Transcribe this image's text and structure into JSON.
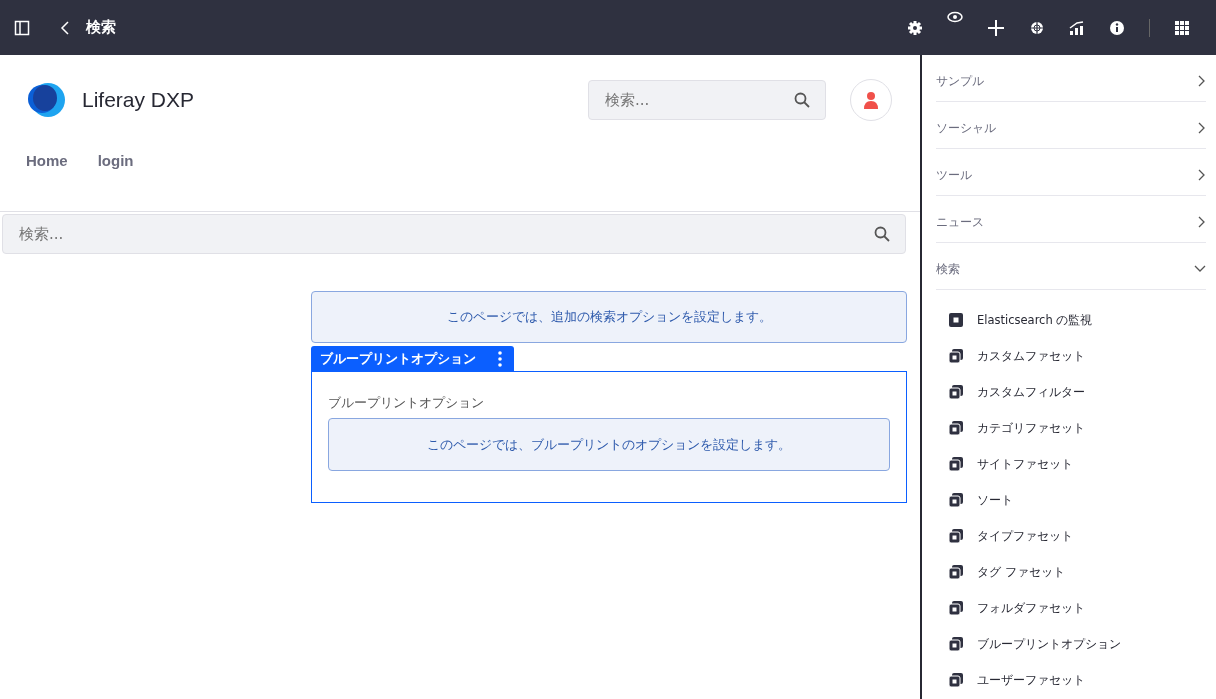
{
  "topbar": {
    "title": "検索"
  },
  "site": {
    "name": "Liferay DXP",
    "search": {
      "placeholder": "検索..."
    },
    "nav": [
      {
        "label": "Home"
      },
      {
        "label": "login"
      }
    ]
  },
  "page_search": {
    "placeholder": "検索..."
  },
  "info_box": "このページでは、追加の検索オプションを設定します。",
  "fragment": {
    "tab": "ブループリントオプション",
    "label": "ブループリントオプション",
    "info": "このページでは、ブループリントのオプションを設定します。"
  },
  "sidebar": {
    "categories": [
      {
        "label": "サンプル",
        "expanded": false
      },
      {
        "label": "ソーシャル",
        "expanded": false
      },
      {
        "label": "ツール",
        "expanded": false
      },
      {
        "label": "ニュース",
        "expanded": false
      },
      {
        "label": "検索",
        "expanded": true,
        "children": [
          {
            "label": "Elasticsearch の監視",
            "kind": "single"
          },
          {
            "label": "カスタムファセット",
            "kind": "stacked"
          },
          {
            "label": "カスタムフィルター",
            "kind": "stacked"
          },
          {
            "label": "カテゴリファセット",
            "kind": "stacked"
          },
          {
            "label": "サイトファセット",
            "kind": "stacked"
          },
          {
            "label": "ソート",
            "kind": "stacked"
          },
          {
            "label": "タイプファセット",
            "kind": "stacked"
          },
          {
            "label": "タグ ファセット",
            "kind": "stacked"
          },
          {
            "label": "フォルダファセット",
            "kind": "stacked"
          },
          {
            "label": "ブループリントオプション",
            "kind": "stacked"
          },
          {
            "label": "ユーザーファセット",
            "kind": "stacked"
          }
        ]
      }
    ]
  }
}
